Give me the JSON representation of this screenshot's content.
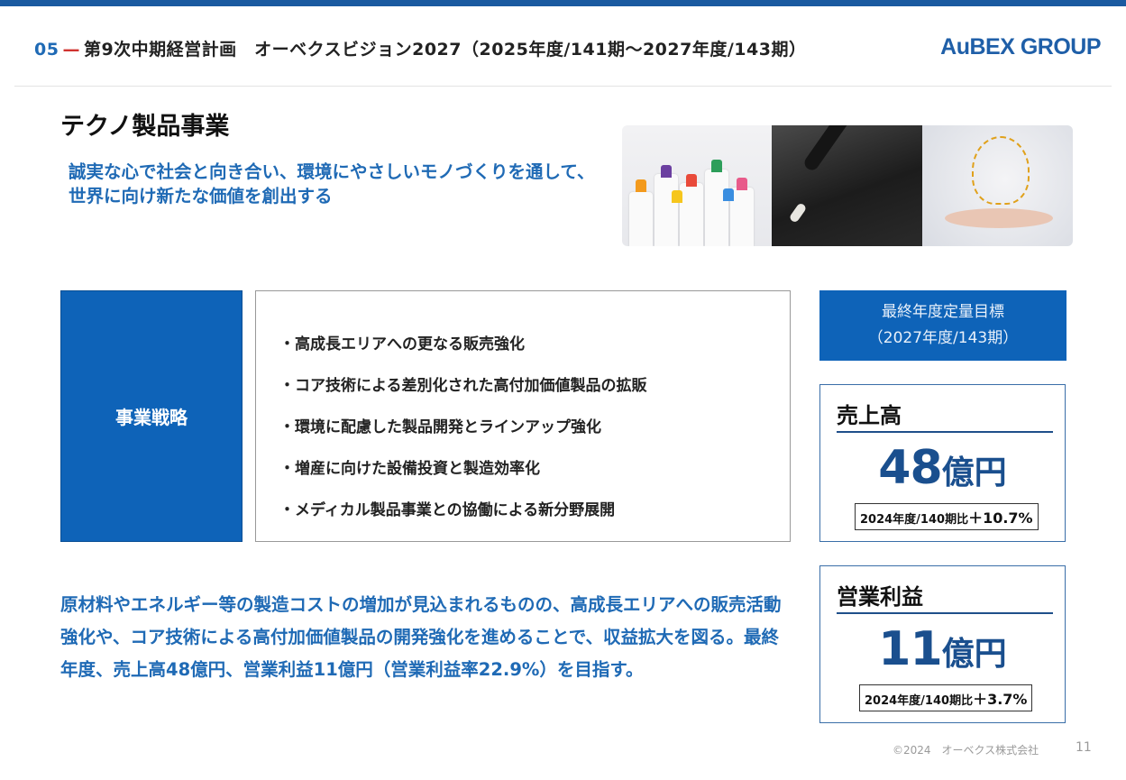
{
  "header": {
    "section_number": "05",
    "dash": "—",
    "title": "第9次中期経営計画　オーベクスビジョン2027（2025年度/141期～2027年度/143期）",
    "brand": "AuBEX GROUP"
  },
  "section": {
    "title": "テクノ製品事業",
    "subtitle": "誠実な心で社会と向き合い、環境にやさしいモノづくりを通して、世界に向け新たな価値を創出する"
  },
  "strategy": {
    "label": "事業戦略",
    "items": [
      "・高成長エリアへの更なる販売強化",
      "・コア技術による差別化された高付加価値製品の拡販",
      "・環境に配慮した製品開発とラインアップ強化",
      "・増産に向けた設備投資と製造効率化",
      "・メディカル製品事業との協働による新分野展開"
    ]
  },
  "targets": {
    "header_line1": "最終年度定量目標",
    "header_line2": "（2027年度/143期）",
    "sales": {
      "title": "売上高",
      "value": "48",
      "unit": "億円",
      "compare_label": "2024年度/140期比",
      "compare_value": "＋10.7%"
    },
    "operating_profit": {
      "title": "営業利益",
      "value": "11",
      "unit": "億円",
      "compare_label": "2024年度/140期比",
      "compare_value": "＋3.7%"
    }
  },
  "body": {
    "text": "原材料やエネルギー等の製造コストの増加が見込まれるものの、高成長エリアへの販売活動強化や、コア技術による高付加価値製品の開発強化を進めることで、収益拡大を図る。最終年度、売上高48億円、営業利益11億円（営業利益率22.9%）を目指す。"
  },
  "footer": {
    "copyright": "©2024　オーベクス株式会社",
    "page": "11"
  },
  "colors": {
    "accent": "#0e63b8",
    "text_blue": "#1f6ab5",
    "dash_red": "#d0332f"
  }
}
